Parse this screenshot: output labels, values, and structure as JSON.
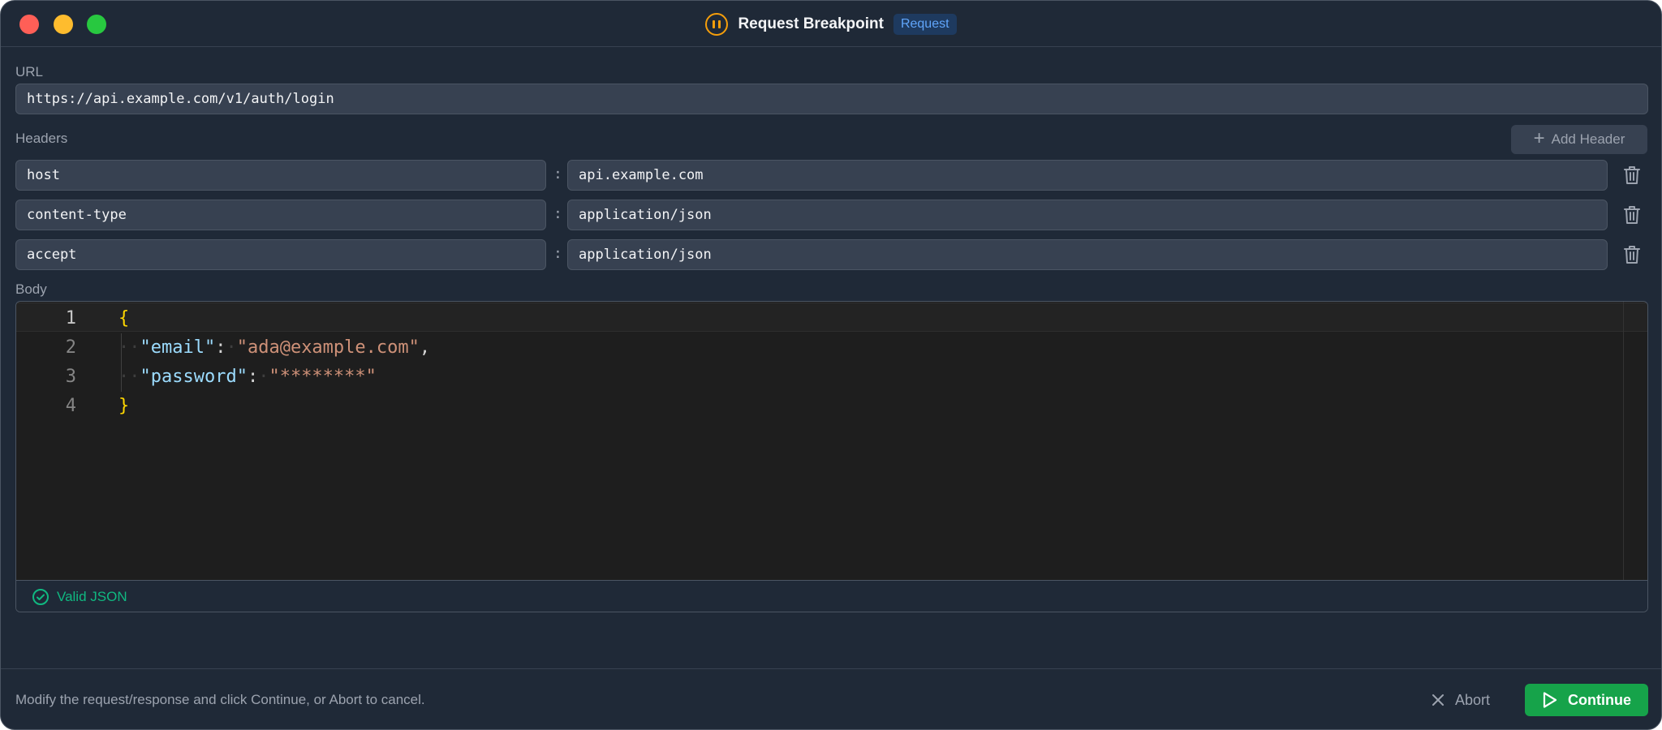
{
  "window": {
    "title": "Request Breakpoint",
    "badge": "Request"
  },
  "url": {
    "label": "URL",
    "value": "https://api.example.com/v1/auth/login"
  },
  "headers": {
    "label": "Headers",
    "add_label": "Add Header",
    "separator": ":",
    "rows": [
      {
        "name": "host",
        "value": "api.example.com"
      },
      {
        "name": "content-type",
        "value": "application/json"
      },
      {
        "name": "accept",
        "value": "application/json"
      }
    ]
  },
  "body": {
    "label": "Body",
    "lines": [
      {
        "number": "1",
        "open": "{"
      },
      {
        "number": "2",
        "indent": "··",
        "key": "\"email\"",
        "colon": ":",
        "space": "·",
        "value": "\"ada@example.com\"",
        "comma": ","
      },
      {
        "number": "3",
        "indent": "··",
        "key": "\"password\"",
        "colon": ":",
        "space": "·",
        "value": "\"********\""
      },
      {
        "number": "4",
        "close": "}"
      }
    ],
    "status": "Valid JSON"
  },
  "footer": {
    "hint": "Modify the request/response and click Continue, or Abort to cancel.",
    "abort_label": "Abort",
    "continue_label": "Continue"
  },
  "colors": {
    "window_bg": "#1f2937",
    "field_bg": "#374151",
    "accent_orange": "#f59e0b",
    "accent_blue": "#60a5fa",
    "success_green": "#10b981",
    "continue_green": "#16a34a"
  }
}
